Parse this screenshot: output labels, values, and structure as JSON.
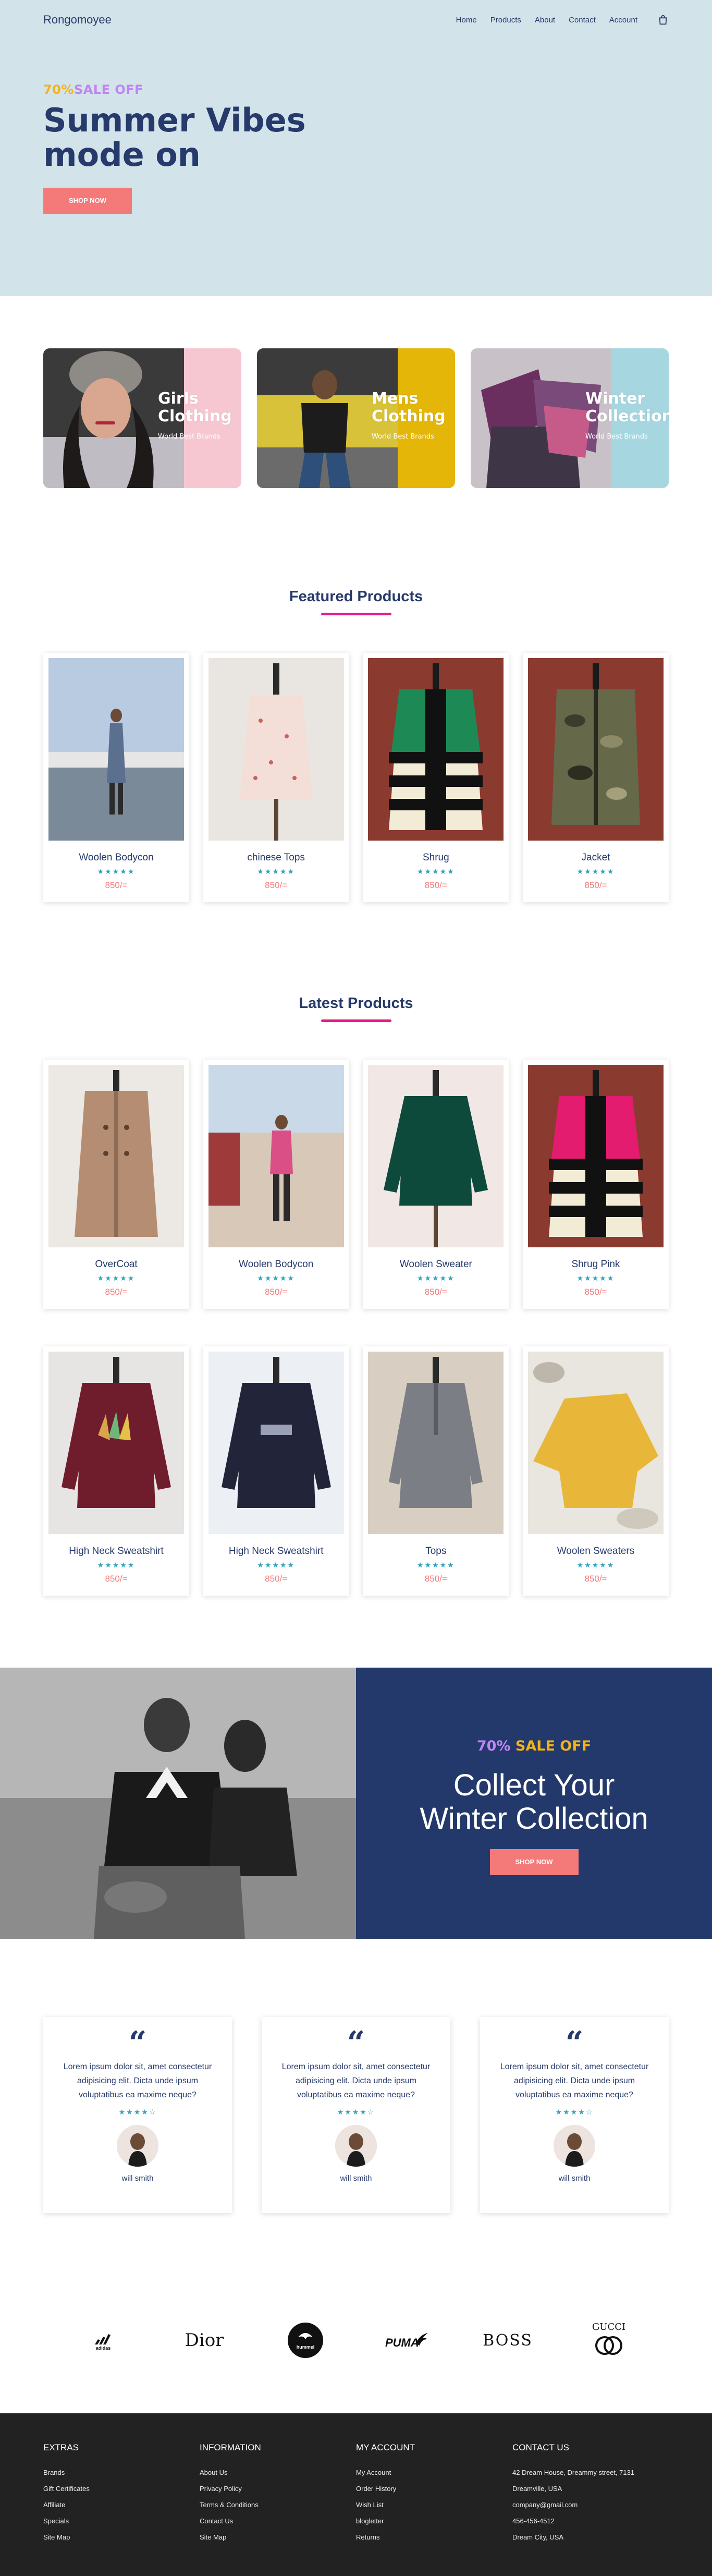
{
  "brand": {
    "logo": "Rongomoyee"
  },
  "nav": {
    "items": [
      "Home",
      "Products",
      "About",
      "Contact",
      "Account"
    ]
  },
  "hero": {
    "sale_pct": "70%",
    "sale_text": "SALE OFF",
    "title": "Summer Vibes mode on",
    "button": "SHOP NOW"
  },
  "categories": [
    {
      "title": "Girls Clothing",
      "subtitle": "World Best Brands",
      "color": "#f6c6d1"
    },
    {
      "title": "Mens Clothing",
      "subtitle": "World Best Brands",
      "color": "#e4b607"
    },
    {
      "title": "Winter Collections",
      "subtitle": "World Best Brands",
      "color": "#a6d7e1"
    }
  ],
  "featured": {
    "title": "Featured Products",
    "products": [
      {
        "name": "Woolen Bodycon",
        "stars": "★★★★★",
        "price": "850/="
      },
      {
        "name": "chinese Tops",
        "stars": "★★★★★",
        "price": "850/="
      },
      {
        "name": "Shrug",
        "stars": "★★★★★",
        "price": "850/="
      },
      {
        "name": "Jacket",
        "stars": "★★★★★",
        "price": "850/="
      }
    ]
  },
  "latest": {
    "title": "Latest Products",
    "row1": [
      {
        "name": "OverCoat",
        "stars": "★★★★★",
        "price": "850/="
      },
      {
        "name": "Woolen Bodycon",
        "stars": "★★★★★",
        "price": "850/="
      },
      {
        "name": "Woolen Sweater",
        "stars": "★★★★★",
        "price": "850/="
      },
      {
        "name": "Shrug Pink",
        "stars": "★★★★★",
        "price": "850/="
      }
    ],
    "row2": [
      {
        "name": "High Neck Sweatshirt",
        "stars": "★★★★★",
        "price": "850/="
      },
      {
        "name": "High Neck Sweatshirt",
        "stars": "★★★★★",
        "price": "850/="
      },
      {
        "name": "Tops",
        "stars": "★★★★★",
        "price": "850/="
      },
      {
        "name": "Woolen Sweaters",
        "stars": "★★★★★",
        "price": "850/="
      }
    ]
  },
  "promo": {
    "sale_pct": "70%",
    "sale_text": "SALE OFF",
    "title_line1": "Collect Your",
    "title_line2": "Winter Collection",
    "button": "SHOP NOW"
  },
  "testimonials": [
    {
      "text": "Lorem ipsum dolor sit, amet consectetur adipisicing elit. Dicta unde ipsum voluptatibus ea maxime neque?",
      "stars": "★★★★☆",
      "name": "will smith"
    },
    {
      "text": "Lorem ipsum dolor sit, amet consectetur adipisicing elit. Dicta unde ipsum voluptatibus ea maxime neque?",
      "stars": "★★★★☆",
      "name": "will smith"
    },
    {
      "text": "Lorem ipsum dolor sit, amet consectetur adipisicing elit. Dicta unde ipsum voluptatibus ea maxime neque?",
      "stars": "★★★★☆",
      "name": "will smith"
    }
  ],
  "brands": [
    "adidas",
    "Dior",
    "hummel",
    "PUMA",
    "BOSS",
    "GUCCI"
  ],
  "footer": {
    "extras": {
      "heading": "EXTRAS",
      "links": [
        "Brands",
        "Gift Certificates",
        "Affiliate",
        "Specials",
        "Site Map"
      ]
    },
    "information": {
      "heading": "INFORMATION",
      "links": [
        "About Us",
        "Privacy Policy",
        "Terms & Conditions",
        "Contact Us",
        "Site Map"
      ]
    },
    "account": {
      "heading": "MY ACCOUNT",
      "links": [
        "My Account",
        "Order History",
        "Wish List",
        "blogletter",
        "Returns"
      ]
    },
    "contact": {
      "heading": "CONTACT US",
      "links": [
        "42 Dream House, Dreammy street, 7131",
        "Dreamville, USA",
        "company@gmail.com",
        "456-456-4512",
        "Dream City, USA"
      ]
    }
  },
  "colors": {
    "accent": "#f47a7a",
    "navy": "#263a6b",
    "pink_line": "#e8198b",
    "star": "#2fa3b8",
    "hero_bg": "#d3e3ea",
    "promo_bg": "#23396b",
    "footer_bg": "#222222"
  }
}
